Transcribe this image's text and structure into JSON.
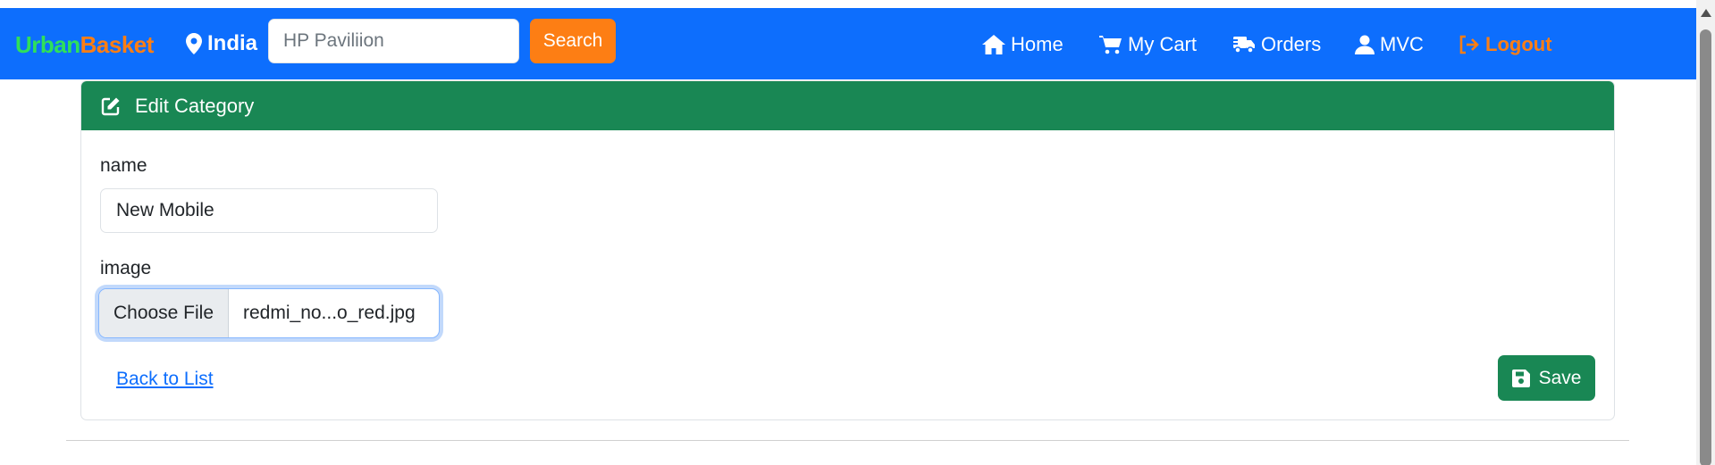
{
  "brand": {
    "part1": "Urban",
    "part2": "Basket"
  },
  "location": {
    "label": "India",
    "icon": "map-pin-icon"
  },
  "search": {
    "placeholder": "HP Paviliion",
    "value": "",
    "button_label": "Search"
  },
  "nav": {
    "home": "Home",
    "cart": "My Cart",
    "orders": "Orders",
    "user": "MVC",
    "logout": "Logout"
  },
  "card": {
    "title": "Edit Category",
    "name_label": "name",
    "name_value": "New Mobile",
    "image_label": "image",
    "choose_file_label": "Choose File",
    "file_name": "redmi_no...o_red.jpg",
    "back_label": "Back to List",
    "save_label": "Save"
  },
  "colors": {
    "navbar": "#0d6efd",
    "brand_green": "#2fe05a",
    "accent_orange": "#fd7e14",
    "header_green": "#198754"
  }
}
